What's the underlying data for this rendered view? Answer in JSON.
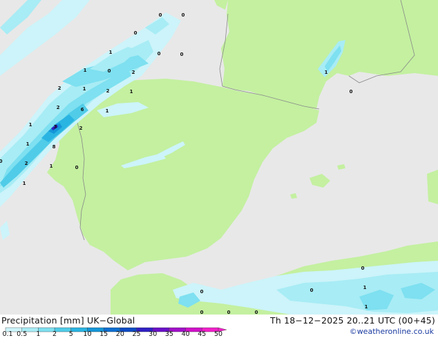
{
  "title_left": "Precipitation [mm]  UK−Global",
  "title_right": "Th 18−12−2025 20..21 UTC (00+45)",
  "credit": "©weatheronline.co.uk",
  "colors": {
    "sea": "#e8e8e8",
    "land": "#c4f0a0",
    "border": "#888888",
    "credit_text": "#1a3aa0"
  },
  "legend": {
    "labels": [
      "0.1",
      "0.5",
      "1",
      "2",
      "5",
      "10",
      "15",
      "20",
      "25",
      "30",
      "35",
      "40",
      "45",
      "50"
    ],
    "colors": [
      "#ccf4fa",
      "#a8ecf5",
      "#7ee0f0",
      "#50cce8",
      "#2ab4e2",
      "#1496d8",
      "#0e6ed0",
      "#0e4ac4",
      "#3020c4",
      "#6a10c8",
      "#a010c8",
      "#d010c8",
      "#f020c8"
    ]
  },
  "map_labels": [
    {
      "text": "0"
    },
    {
      "text": "0"
    },
    {
      "text": "0"
    },
    {
      "text": "1"
    },
    {
      "text": "0"
    },
    {
      "text": "0"
    },
    {
      "text": "1"
    },
    {
      "text": "0"
    },
    {
      "text": "2"
    },
    {
      "text": "2"
    },
    {
      "text": "1"
    },
    {
      "text": "2"
    },
    {
      "text": "1"
    },
    {
      "text": "2"
    },
    {
      "text": "6"
    },
    {
      "text": "1"
    },
    {
      "text": "1"
    },
    {
      "text": "3"
    },
    {
      "text": "2"
    },
    {
      "text": "1"
    },
    {
      "text": "8"
    },
    {
      "text": "0"
    },
    {
      "text": "2"
    },
    {
      "text": "1"
    },
    {
      "text": "0"
    },
    {
      "text": "1"
    },
    {
      "text": "1"
    },
    {
      "text": "0"
    },
    {
      "text": "0"
    },
    {
      "text": "0"
    },
    {
      "text": "0"
    },
    {
      "text": "1"
    },
    {
      "text": "0"
    },
    {
      "text": "0"
    },
    {
      "text": "0"
    },
    {
      "text": "1"
    }
  ]
}
